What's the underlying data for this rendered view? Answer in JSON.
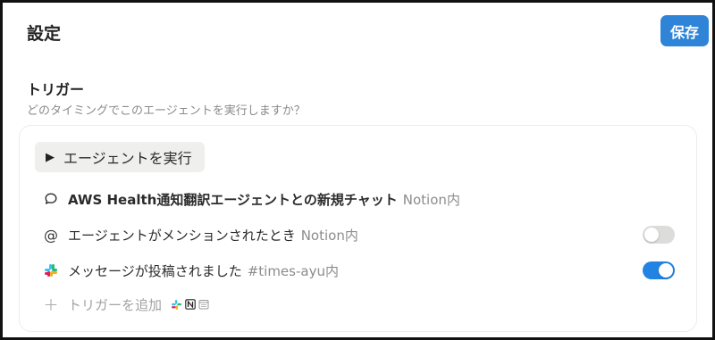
{
  "header": {
    "title": "設定",
    "save_label": "保存"
  },
  "trigger_section": {
    "heading": "トリガー",
    "subtitle": "どのタイミングでこのエージェントを実行しますか？",
    "run_button_label": "エージェントを実行",
    "items": [
      {
        "icon": "chat-bubble-icon",
        "label": "AWS Health通知翻訳エージェントとの新規チャット",
        "scope": "Notion内"
      },
      {
        "icon": "at-sign-icon",
        "label": "エージェントがメンションされたとき",
        "scope": "Notion内",
        "enabled": false
      },
      {
        "icon": "slack-icon",
        "label": "メッセージが投稿されました",
        "scope": "#times-ayu内",
        "enabled": true
      }
    ],
    "add_trigger_label": "トリガーを追加",
    "add_trigger_sources": [
      "slack-icon",
      "notion-icon",
      "calendar-icon"
    ]
  },
  "colors": {
    "accent": "#2383e2",
    "save_button": "#2f84d8",
    "toggle_off": "#dcdcda",
    "muted_text": "#8c8c8c"
  }
}
